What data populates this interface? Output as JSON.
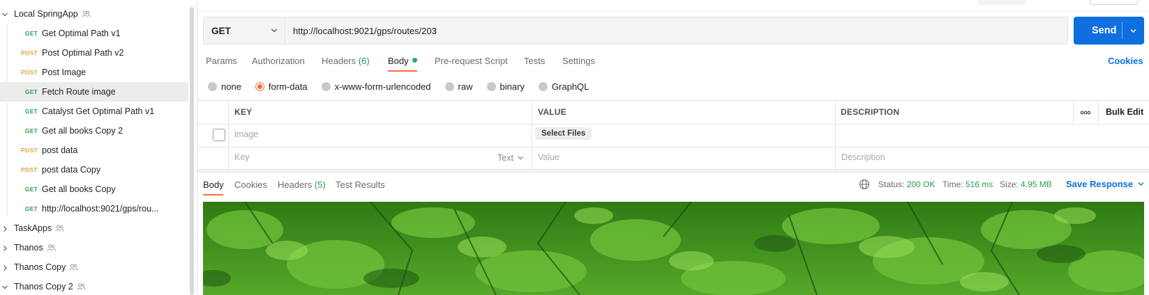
{
  "sidebar": {
    "collection_open": "Local SpringApp",
    "requests": [
      {
        "method": "GET",
        "label": "Get Optimal Path v1"
      },
      {
        "method": "POST",
        "label": "Post Optimal Path v2"
      },
      {
        "method": "POST",
        "label": "Post Image"
      },
      {
        "method": "GET",
        "label": "Fetch Route image"
      },
      {
        "method": "GET",
        "label": "Catalyst Get Optimal Path v1"
      },
      {
        "method": "GET",
        "label": "Get all books Copy 2"
      },
      {
        "method": "POST",
        "label": "post data"
      },
      {
        "method": "POST",
        "label": "post data Copy"
      },
      {
        "method": "GET",
        "label": "Get all books Copy"
      },
      {
        "method": "GET",
        "label": "http://localhost:9021/gps/rou..."
      }
    ],
    "selected_request": "Fetch Route image",
    "collections": [
      "TaskApps",
      "Thanos",
      "Thanos Copy",
      "Thanos Copy 2"
    ]
  },
  "request": {
    "method": "GET",
    "url": "http://localhost:9021/gps/routes/203",
    "send_label": "Send",
    "tabs": {
      "params": "Params",
      "authorization": "Authorization",
      "headers": "Headers",
      "headers_count": "(6)",
      "body": "Body",
      "prerequest": "Pre-request Script",
      "tests": "Tests",
      "settings": "Settings"
    },
    "cookies_label": "Cookies",
    "body_types": [
      "none",
      "form-data",
      "x-www-form-urlencoded",
      "raw",
      "binary",
      "GraphQL"
    ],
    "body_type_selected": "form-data"
  },
  "form_table": {
    "headers": {
      "key": "KEY",
      "value": "VALUE",
      "description": "DESCRIPTION",
      "bulk_edit": "Bulk Edit"
    },
    "row": {
      "key": "image",
      "value_button": "Select Files"
    },
    "empty_row": {
      "key_placeholder": "Key",
      "type": "Text",
      "value_placeholder": "Value",
      "description_placeholder": "Description"
    }
  },
  "response": {
    "tabs": {
      "body": "Body",
      "cookies": "Cookies",
      "headers": "Headers",
      "headers_count": "(5)",
      "test_results": "Test Results"
    },
    "status_label": "Status:",
    "status_value": "200 OK",
    "time_label": "Time:",
    "time_value": "516 ms",
    "size_label": "Size:",
    "size_value": "4.95 MB",
    "save_label": "Save Response"
  },
  "colors": {
    "accent": "#0f6fde",
    "active_tab": "#ff6c37",
    "get": "#2e9b4f",
    "post": "#e6a23c",
    "success": "#2e9b4f"
  }
}
